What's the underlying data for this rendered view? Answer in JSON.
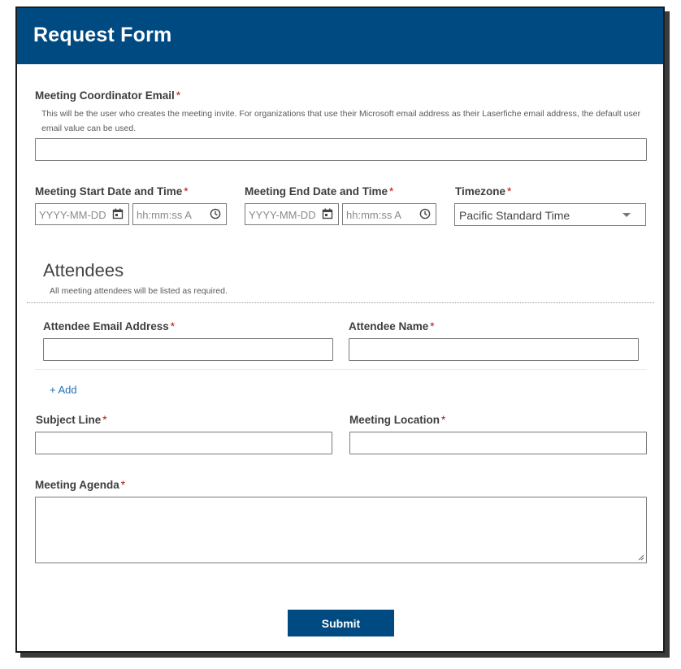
{
  "header": {
    "title": "Request Form"
  },
  "coordinator": {
    "label": "Meeting Coordinator Email",
    "required": "*",
    "help": "This will be the user who creates the meeting invite. For organizations that use their Microsoft email address as their Laserfiche email address, the default user email value can be used."
  },
  "start": {
    "label": "Meeting Start Date and Time",
    "required": "*",
    "date_placeholder": "YYYY-MM-DD",
    "time_placeholder": "hh:mm:ss A"
  },
  "end": {
    "label": "Meeting End Date and Time",
    "required": "*",
    "date_placeholder": "YYYY-MM-DD",
    "time_placeholder": "hh:mm:ss A"
  },
  "timezone": {
    "label": "Timezone",
    "required": "*",
    "value": "Pacific Standard Time"
  },
  "attendees": {
    "title": "Attendees",
    "help": "All meeting attendees will be listed as required.",
    "email_label": "Attendee Email Address",
    "name_label": "Attendee Name",
    "required": "*",
    "add_label": "+ Add"
  },
  "subject": {
    "label": "Subject Line",
    "required": "*"
  },
  "location": {
    "label": "Meeting Location",
    "required": "*"
  },
  "agenda": {
    "label": "Meeting Agenda",
    "required": "*"
  },
  "submit": {
    "label": "Submit"
  }
}
